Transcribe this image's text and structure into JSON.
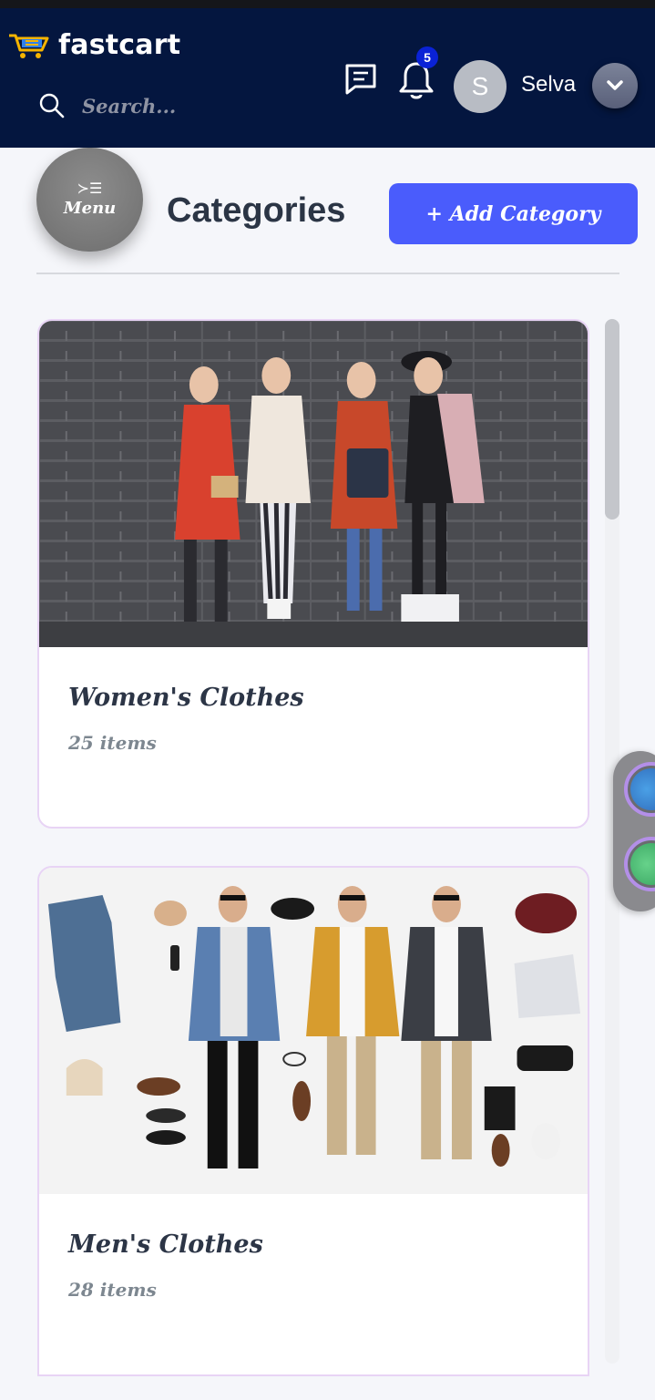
{
  "header": {
    "brand": "fastcart",
    "search_placeholder": "Search...",
    "notification_count": "5",
    "user": {
      "initial": "S",
      "name": "Selva"
    }
  },
  "toolbar": {
    "menu_label": "Menu",
    "menu_icon": "≻☰",
    "page_title": "Categories",
    "add_button": "+ Add Category"
  },
  "categories": [
    {
      "title": "Women's Clothes",
      "count": "25 items"
    },
    {
      "title": "Men's Clothes",
      "count": "28 items"
    }
  ],
  "colors": {
    "header_bg": "#04163f",
    "accent": "#4a5cfc",
    "badge": "#0a22d6",
    "card_border": "#e8d4f5"
  },
  "icons": [
    "cart-logo-icon",
    "search-icon",
    "message-icon",
    "bell-icon",
    "chevron-down-icon",
    "menu-icon"
  ]
}
